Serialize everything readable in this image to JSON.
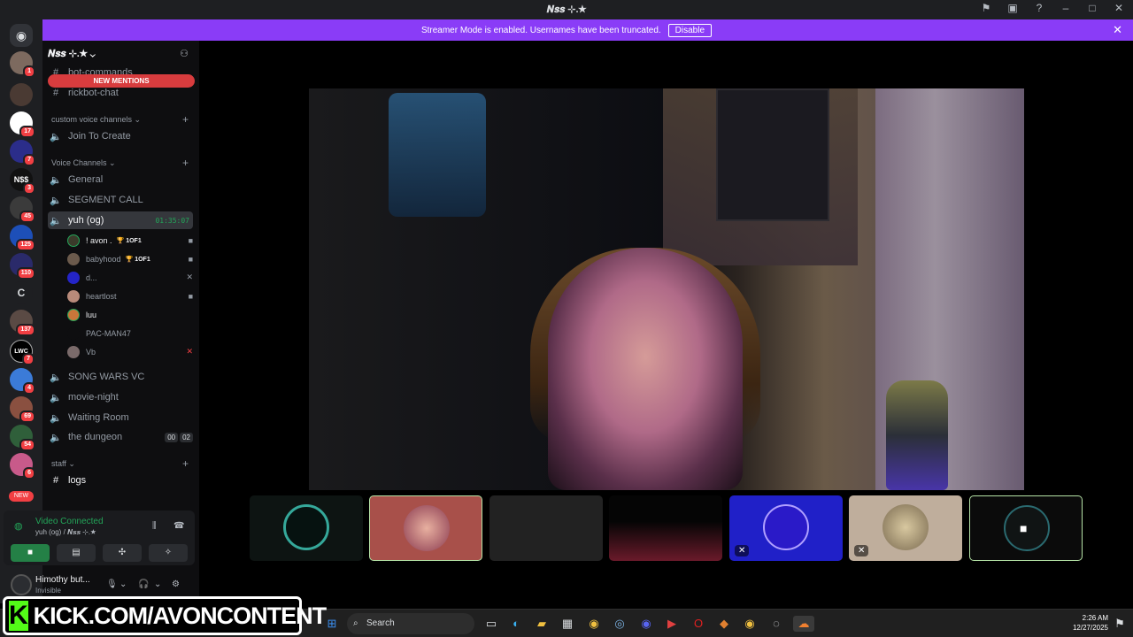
{
  "window": {
    "title": "𝑵𝒔𝒔 ⊹.★"
  },
  "banner": {
    "text": "Streamer Mode is enabled. Usernames have been truncated.",
    "button": "Disable"
  },
  "rail": {
    "badges": [
      "1",
      "",
      "17",
      "7",
      "3",
      "45",
      "125",
      "110",
      "",
      "137",
      "7",
      "4",
      "69",
      "54",
      "6"
    ],
    "letter_server": "C",
    "lwc_label": "LWC",
    "new_label": "NEW"
  },
  "sidebar": {
    "server_name": "𝑵𝒔𝒔 ⊹.★",
    "new_mentions": "NEW MENTIONS",
    "channels_top": [
      {
        "name": "bot-commands"
      },
      {
        "name": "rickbot-chat"
      }
    ],
    "category_custom": "custom voice channels",
    "join_to_create": "Join To Create",
    "category_voice": "Voice Channels",
    "voice_channels": [
      "General",
      "SEGMENT CALL"
    ],
    "active_channel": {
      "name": "yuh (og)",
      "timer": "01:35:07"
    },
    "members": [
      {
        "name": "! avon .",
        "trophy": "1OF1",
        "right": "■"
      },
      {
        "name": "babyhood",
        "trophy": "1OF1",
        "right": "■"
      },
      {
        "name": "d...",
        "trophy": "",
        "right": "✕"
      },
      {
        "name": "heartlost",
        "trophy": "",
        "right": "■"
      },
      {
        "name": "luu",
        "trophy": "",
        "right": ""
      },
      {
        "name": "PAC-MAN47",
        "trophy": "",
        "right": ""
      },
      {
        "name": "Vb",
        "trophy": "",
        "right": "✕"
      }
    ],
    "more_channels": [
      "SONG WARS VC",
      "movie-night",
      "Waiting Room",
      "the dungeon"
    ],
    "dungeon_counts": [
      "00",
      "02"
    ],
    "category_staff": "staff",
    "logs": "logs"
  },
  "voice_panel": {
    "title": "Video Connected",
    "subtitle": "yuh (og) / 𝑵𝒔𝒔 ⊹.★"
  },
  "user_panel": {
    "name": "Himothy but...",
    "status": "Invisible"
  },
  "taskbar": {
    "search": "Search",
    "time": "2:26 AM",
    "date": "12/27/2025"
  },
  "overlay": {
    "kick_text": "KICK.COM/AVONCONTENT",
    "k": "K"
  },
  "colors": {
    "accent": "#8a3cf7",
    "online": "#23a559",
    "mention": "#d83c3e"
  }
}
